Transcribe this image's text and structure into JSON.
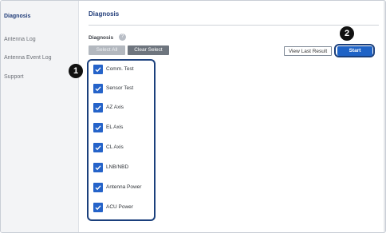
{
  "sidebar": {
    "items": [
      {
        "label": "Diagnosis",
        "active": true
      },
      {
        "label": "Antenna Log",
        "active": false
      },
      {
        "label": "Antenna Event Log",
        "active": false
      },
      {
        "label": "Support",
        "active": false
      }
    ]
  },
  "main": {
    "title": "Diagnosis",
    "section_label": "Diagnosis",
    "info_icon_text": "?",
    "buttons": {
      "select_all": "Select All",
      "clear_select": "Clear Select",
      "view_last_result": "View Last Result",
      "start": "Start"
    },
    "checklist": [
      {
        "label": "Comm. Test",
        "checked": true
      },
      {
        "label": "Sensor Test",
        "checked": true
      },
      {
        "label": "AZ Axis",
        "checked": true
      },
      {
        "label": "EL Axis",
        "checked": true
      },
      {
        "label": "CL Axis",
        "checked": true
      },
      {
        "label": "LNB/NBD",
        "checked": true
      },
      {
        "label": "Antenna Power",
        "checked": true
      },
      {
        "label": "ACU Power",
        "checked": true
      }
    ]
  },
  "callouts": {
    "one": "1",
    "two": "2"
  },
  "colors": {
    "accent": "#1f63c6",
    "title": "#1f3b78",
    "highlight_outline": "#1a3f7c",
    "checkbox": "#2563c9"
  }
}
